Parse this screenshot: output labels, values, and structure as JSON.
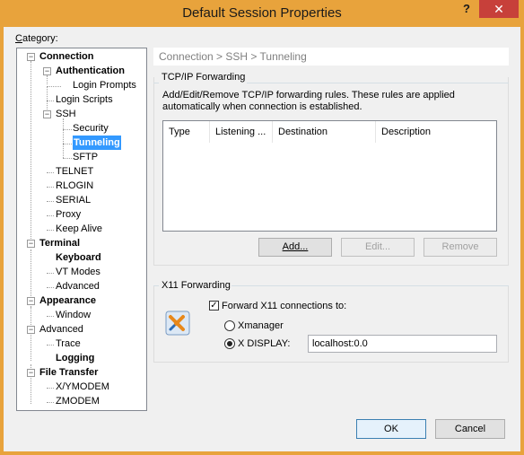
{
  "window": {
    "title": "Default Session Properties",
    "help": "?",
    "close": "✕"
  },
  "category_label": "Category:",
  "tree": [
    {
      "label": "Connection",
      "bold": true
    },
    {
      "label": "Authentication",
      "bold": true
    },
    {
      "label": "Login Prompts",
      "bold": false
    },
    {
      "label": "Login Scripts",
      "bold": false
    },
    {
      "label": "SSH",
      "bold": false
    },
    {
      "label": "Security",
      "bold": false
    },
    {
      "label": "Tunneling",
      "bold": true,
      "selected": true
    },
    {
      "label": "SFTP",
      "bold": false
    },
    {
      "label": "TELNET",
      "bold": false
    },
    {
      "label": "RLOGIN",
      "bold": false
    },
    {
      "label": "SERIAL",
      "bold": false
    },
    {
      "label": "Proxy",
      "bold": false
    },
    {
      "label": "Keep Alive",
      "bold": false
    },
    {
      "label": "Terminal",
      "bold": true
    },
    {
      "label": "Keyboard",
      "bold": true
    },
    {
      "label": "VT Modes",
      "bold": false
    },
    {
      "label": "Advanced",
      "bold": false
    },
    {
      "label": "Appearance",
      "bold": true
    },
    {
      "label": "Window",
      "bold": false
    },
    {
      "label": "Advanced",
      "bold": false
    },
    {
      "label": "Trace",
      "bold": false
    },
    {
      "label": "Logging",
      "bold": true
    },
    {
      "label": "File Transfer",
      "bold": true
    },
    {
      "label": "X/YMODEM",
      "bold": false
    },
    {
      "label": "ZMODEM",
      "bold": false
    }
  ],
  "breadcrumb": "Connection > SSH > Tunneling",
  "tcpip": {
    "title": "TCP/IP Forwarding",
    "description": "Add/Edit/Remove TCP/IP forwarding rules. These rules are applied automatically when connection is established.",
    "columns": [
      "Type",
      "Listening ...",
      "Destination",
      "Description"
    ],
    "add_label": "Add...",
    "edit_label": "Edit...",
    "remove_label": "Remove"
  },
  "x11": {
    "title": "X11 Forwarding",
    "forward_label": "Forward X11 connections to:",
    "forward_checked": true,
    "xmanager_label": "Xmanager",
    "xdisplay_label": "X DISPLAY:",
    "selected": "xdisplay",
    "xdisplay_value": "localhost:0.0"
  },
  "buttons": {
    "ok": "OK",
    "cancel": "Cancel"
  }
}
